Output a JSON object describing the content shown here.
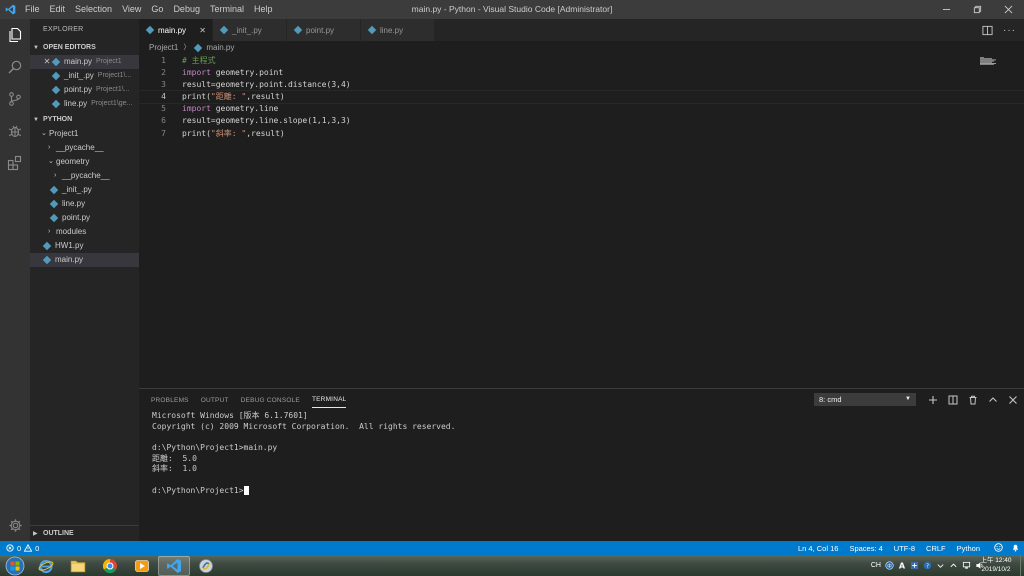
{
  "window": {
    "title": "main.py - Python - Visual Studio Code [Administrator]",
    "menu": [
      "File",
      "Edit",
      "Selection",
      "View",
      "Go",
      "Debug",
      "Terminal",
      "Help"
    ]
  },
  "sidebar": {
    "header": "EXPLORER",
    "open_editors": {
      "label": "OPEN EDITORS",
      "items": [
        {
          "name": "main.py",
          "desc": "Project1"
        },
        {
          "name": "_init_.py",
          "desc": "Project1\\..."
        },
        {
          "name": "point.py",
          "desc": "Project1\\..."
        },
        {
          "name": "line.py",
          "desc": "Project1\\ge..."
        }
      ]
    },
    "workspace": {
      "label": "PYTHON",
      "tree": [
        {
          "label": "Project1"
        },
        {
          "label": "__pycache__"
        },
        {
          "label": "geometry"
        },
        {
          "label": "__pycache__"
        },
        {
          "label": "_init_.py"
        },
        {
          "label": "line.py"
        },
        {
          "label": "point.py"
        },
        {
          "label": "modules"
        },
        {
          "label": "HW1.py"
        },
        {
          "label": "main.py"
        }
      ]
    },
    "outline_label": "OUTLINE"
  },
  "tabs": [
    {
      "label": "main.py"
    },
    {
      "label": "_init_.py"
    },
    {
      "label": "point.py"
    },
    {
      "label": "line.py"
    }
  ],
  "breadcrumb": {
    "folder": "Project1",
    "file": "main.py"
  },
  "editor": {
    "line_numbers": [
      "1",
      "2",
      "3",
      "4",
      "5",
      "6",
      "7"
    ],
    "lines": [
      {
        "t1": "# 主程式"
      },
      {
        "t1": "import",
        "t2": " geometry.point"
      },
      {
        "t1": "result=geometry.point.",
        "t2": "distance",
        "t3": "(3,4)"
      },
      {
        "t1": "print",
        "t2": "(",
        "t3": "\"距離: \"",
        "t4": ",result)"
      },
      {
        "t1": "import",
        "t2": " geometry.line"
      },
      {
        "t1": "result=geometry.line.",
        "t2": "slope",
        "t3": "(1,1,3,3)"
      },
      {
        "t1": "print",
        "t2": "(",
        "t3": "\"斜率: \"",
        "t4": ",result)"
      }
    ]
  },
  "panel": {
    "tabs": [
      "PROBLEMS",
      "OUTPUT",
      "DEBUG CONSOLE",
      "TERMINAL"
    ],
    "terminal_select": "8: cmd",
    "terminal_lines": [
      "Microsoft Windows [版本 6.1.7601]",
      "Copyright (c) 2009 Microsoft Corporation.  All rights reserved.",
      "",
      "d:\\Python\\Project1>main.py",
      "距離:  5.0",
      "斜率:  1.0",
      "",
      "d:\\Python\\Project1>"
    ]
  },
  "statusbar": {
    "errors": "0",
    "warnings": "0",
    "position": "Ln 4, Col 16",
    "spaces": "Spaces: 4",
    "encoding": "UTF-8",
    "eol": "CRLF",
    "language": "Python"
  },
  "taskbar": {
    "tray_lang": "CH",
    "clock_time": "上午 12:40",
    "clock_date": "2019/10/2"
  },
  "colors": {
    "accent": "#007acc",
    "editor_bg": "#1e1e1e",
    "sidebar_bg": "#252526",
    "keyword": "#c586c0",
    "string": "#ce9178",
    "function": "#dcdcaa",
    "comment": "#6a9955",
    "python_icon": "#519aba"
  },
  "icons": [
    "vscode-logo-icon",
    "files-icon",
    "search-icon",
    "source-control-icon",
    "debug-icon",
    "extensions-icon",
    "gear-icon",
    "python-file-icon",
    "close-icon",
    "chevron-down-icon",
    "chevron-right-icon",
    "split-editor-icon",
    "more-icon",
    "add-terminal-icon",
    "split-terminal-icon",
    "trash-icon",
    "maximize-panel-icon",
    "close-panel-icon",
    "error-icon",
    "warning-icon",
    "smiley-icon",
    "bell-icon",
    "windows-start-icon",
    "ie-icon",
    "folder-icon",
    "chrome-icon",
    "media-icon",
    "vscode-icon",
    "idle-icon"
  ]
}
